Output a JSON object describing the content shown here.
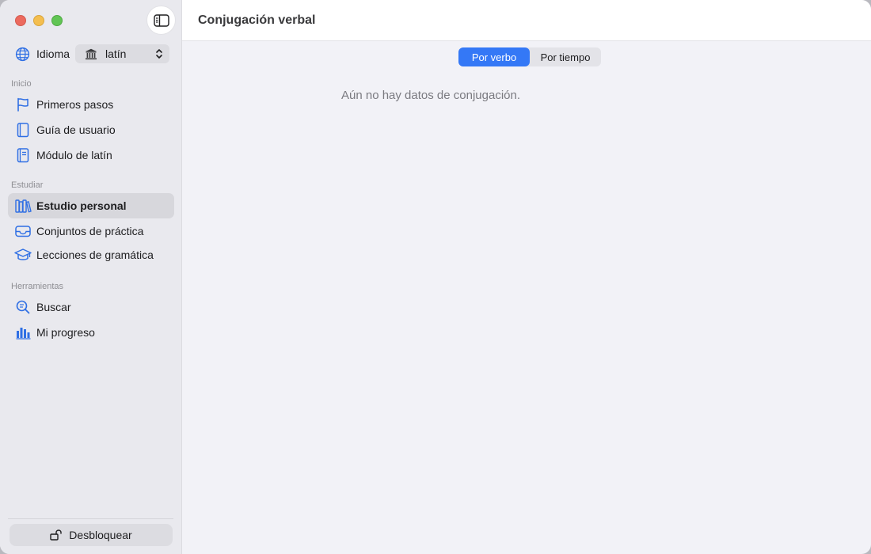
{
  "window": {
    "title": "Conjugación verbal"
  },
  "sidebar": {
    "language": {
      "label": "Idioma",
      "selected": "latín"
    },
    "sections": [
      {
        "title": "Inicio",
        "items": [
          {
            "label": "Primeros pasos",
            "icon": "flag-icon"
          },
          {
            "label": "Guía de usuario",
            "icon": "book-icon"
          },
          {
            "label": "Módulo de latín",
            "icon": "book-module-icon"
          }
        ]
      },
      {
        "title": "Estudiar",
        "items": [
          {
            "label": "Estudio personal",
            "icon": "books-icon",
            "active": true
          },
          {
            "label": "Conjuntos de práctica",
            "icon": "tray-icon"
          },
          {
            "label": "Lecciones de gramática",
            "icon": "graduation-cap-icon"
          }
        ]
      },
      {
        "title": "Herramientas",
        "items": [
          {
            "label": "Buscar",
            "icon": "search-icon"
          },
          {
            "label": "Mi progreso",
            "icon": "chart-bars-icon"
          }
        ]
      }
    ],
    "footer": {
      "unlock_label": "Desbloquear"
    }
  },
  "main": {
    "segments": [
      "Por verbo",
      "Por tiempo"
    ],
    "selected_segment": "Por verbo",
    "empty_message": "Aún no hay datos de conjugación."
  },
  "colors": {
    "accent": "#3478f6",
    "icon_blue": "#2f6fe4"
  }
}
